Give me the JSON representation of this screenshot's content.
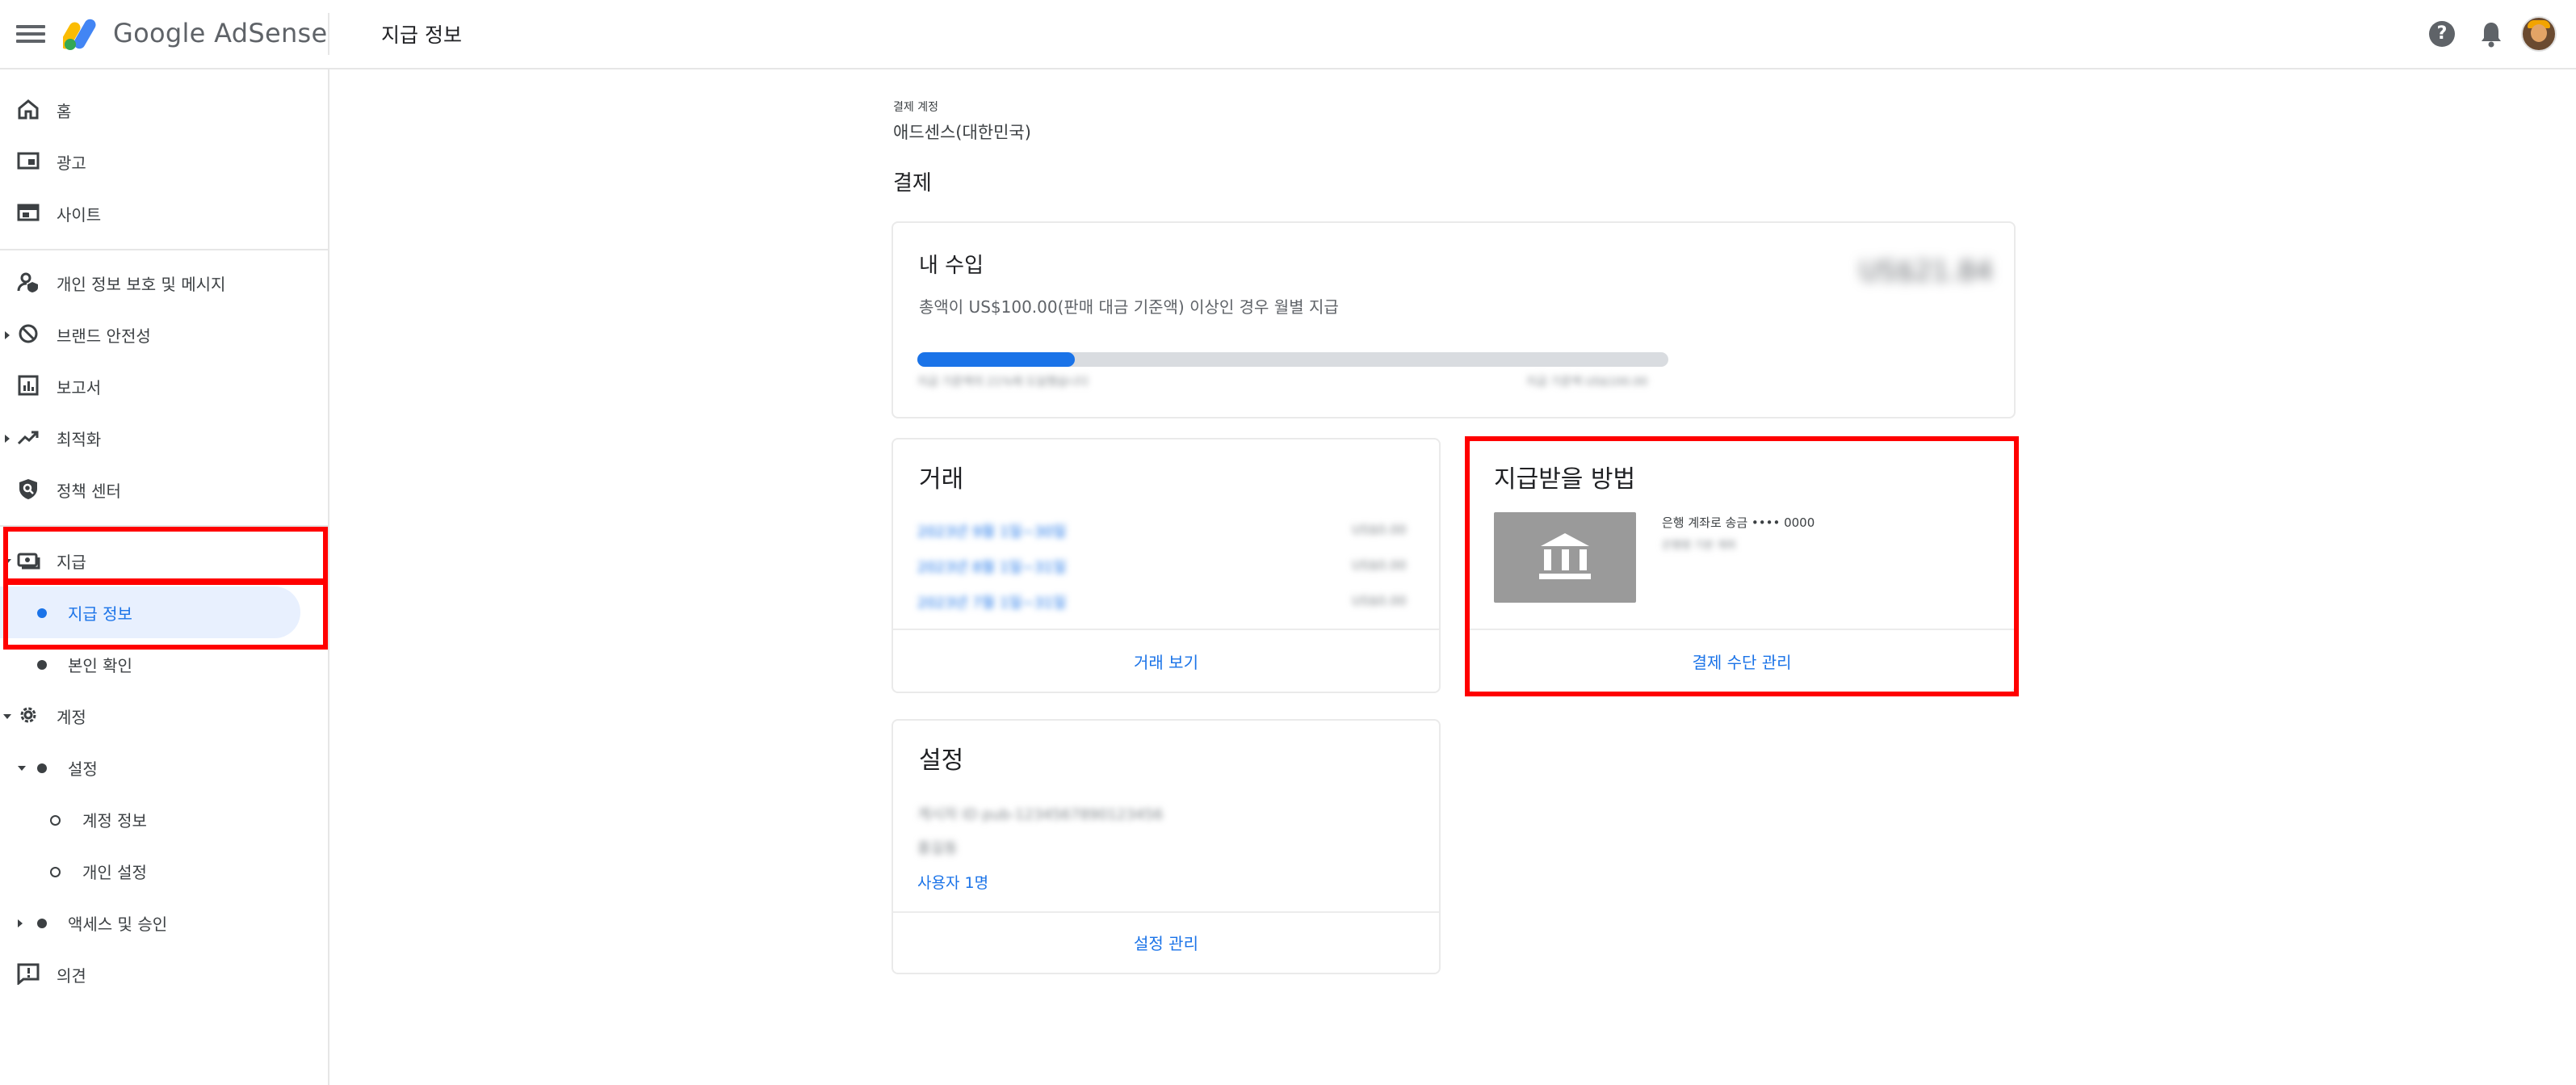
{
  "header": {
    "brand": "Google AdSense",
    "page_title": "지급 정보",
    "icons": [
      "menu-icon",
      "adsense-logo",
      "help-icon",
      "bell-icon",
      "avatar"
    ]
  },
  "sidebar": {
    "items": [
      {
        "label": "홈",
        "icon": "home-icon"
      },
      {
        "label": "광고",
        "icon": "ads-icon"
      },
      {
        "label": "사이트",
        "icon": "sites-icon"
      },
      {
        "label": "개인 정보 보호 및 메시지",
        "icon": "privacy-icon"
      },
      {
        "label": "브랜드 안전성",
        "icon": "block-icon"
      },
      {
        "label": "보고서",
        "icon": "reports-icon"
      },
      {
        "label": "최적화",
        "icon": "trending-icon"
      },
      {
        "label": "정책 센터",
        "icon": "policy-icon"
      },
      {
        "label": "지급",
        "icon": "payments-icon"
      },
      {
        "label": "지급 정보",
        "active": true
      },
      {
        "label": "본인 확인"
      },
      {
        "label": "계정",
        "icon": "gear-icon"
      },
      {
        "label": "설정"
      },
      {
        "label": "계정 정보"
      },
      {
        "label": "개인 설정"
      },
      {
        "label": "액세스 및 승인"
      },
      {
        "label": "의견",
        "icon": "feedback-icon"
      }
    ]
  },
  "main": {
    "account_label": "결제 계정",
    "account_name": "애드센스(대한민국)",
    "section_title": "결제",
    "earnings": {
      "title": "내 수입",
      "amount": "US$21.84",
      "description": "총액이 US$100.00(판매 대금 기준액) 이상인 경우 월별 지급",
      "progress_fraction": 0.21,
      "progress_left_caption": "지급 기준액의 21%에 도달했습니다",
      "progress_right_caption": "지급 기준액 US$100.00"
    },
    "transactions": {
      "title": "거래",
      "rows": [
        {
          "date": "2023년 9월 1일~30일",
          "amount": "US$0.00"
        },
        {
          "date": "2023년 8월 1일~31일",
          "amount": "US$0.00"
        },
        {
          "date": "2023년 7월 1일~31일",
          "amount": "US$0.00"
        }
      ],
      "link": "거래 보기"
    },
    "payment_method": {
      "title": "지급받을 방법",
      "line1": "은행 계좌로 송금 •••• 0000",
      "line2": "은행명 기본 계좌",
      "link": "결제 수단 관리"
    },
    "settings": {
      "title": "설정",
      "line1": "게시자 ID pub-1234567890123456",
      "line2": "홍길동",
      "users": "사용자 1명",
      "link": "설정 관리"
    }
  },
  "colors": {
    "accent": "#1a73e8",
    "highlight": "#ff0000",
    "active_bg": "#e8f0fe"
  }
}
